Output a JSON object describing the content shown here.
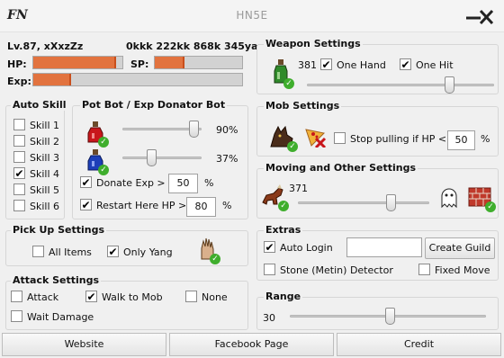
{
  "window": {
    "title": "HN5E",
    "logo": "FN"
  },
  "player": {
    "level_name": "Lv.87, xXxzZz",
    "currency": "0kkk 222kk 868k 345yang",
    "hp_label": "HP:",
    "sp_label": "SP:",
    "exp_label": "Exp:",
    "hp": 0.93,
    "sp": 0.34,
    "exp": 0.18
  },
  "auto_skill": {
    "title": "Auto Skill",
    "skills": [
      {
        "label": "Skill 1",
        "checked": false
      },
      {
        "label": "Skill 2",
        "checked": false
      },
      {
        "label": "Skill 3",
        "checked": false
      },
      {
        "label": "Skill 4",
        "checked": true
      },
      {
        "label": "Skill 5",
        "checked": false
      },
      {
        "label": "Skill 6",
        "checked": false
      }
    ]
  },
  "pot_bot": {
    "title": "Pot Bot / Exp Donator Bot",
    "hp_pot_value": "90%",
    "hp_pot_level": 0.9,
    "mp_pot_value": "37%",
    "mp_pot_level": 0.37,
    "donate_label": "Donate Exp >",
    "donate_value": "50",
    "donate_unit": "%",
    "donate_checked": true,
    "restart_label": "Restart Here HP >",
    "restart_value": "80",
    "restart_unit": "%",
    "restart_checked": true
  },
  "pickup": {
    "title": "Pick Up Settings",
    "all_items": "All Items",
    "all_items_checked": false,
    "only_yang": "Only Yang",
    "only_yang_checked": true
  },
  "attack": {
    "title": "Attack Settings",
    "attack": "Attack",
    "attack_checked": false,
    "walk": "Walk to Mob",
    "walk_checked": true,
    "none": "None",
    "none_checked": false,
    "wait": "Wait Damage",
    "wait_checked": false
  },
  "weapon": {
    "title": "Weapon Settings",
    "value": "381",
    "one_hand": "One Hand",
    "one_hand_checked": true,
    "one_hit": "One Hit",
    "one_hit_checked": true,
    "slider_level": 0.76
  },
  "mob": {
    "title": "Mob Settings",
    "stop_label": "Stop pulling if HP <",
    "stop_value": "50",
    "stop_unit": "%",
    "stop_checked": false
  },
  "moving": {
    "title": "Moving and Other Settings",
    "value": "371",
    "slider_level": 0.71
  },
  "extras": {
    "title": "Extras",
    "auto_login": "Auto Login",
    "auto_login_checked": true,
    "create_guild": "Create Guild",
    "guild_input": "",
    "stone": "Stone (Metin) Detector",
    "stone_checked": false,
    "fixed_move": "Fixed Move",
    "fixed_move_checked": false
  },
  "range": {
    "title": "Range",
    "value": "30",
    "slider_level": 0.51
  },
  "footer": {
    "website": "Website",
    "facebook": "Facebook Page",
    "credit": "Credit"
  },
  "icons": {
    "hp_potion": "red-potion-icon",
    "mp_potion": "blue-potion-icon",
    "weapon": "poison-bottle-icon",
    "mob_a": "wolf-icon",
    "mob_b": "pizza-no-icon",
    "moving": "horse-icon",
    "ghost": "ghost-icon",
    "wall": "brick-wall-icon",
    "pickup": "hand-icon",
    "check_badge": "green-check-icon"
  },
  "colors": {
    "bar_fill": "#e2733f",
    "bar_track": "#d2d2d2",
    "check_badge": "#3fae2d"
  }
}
